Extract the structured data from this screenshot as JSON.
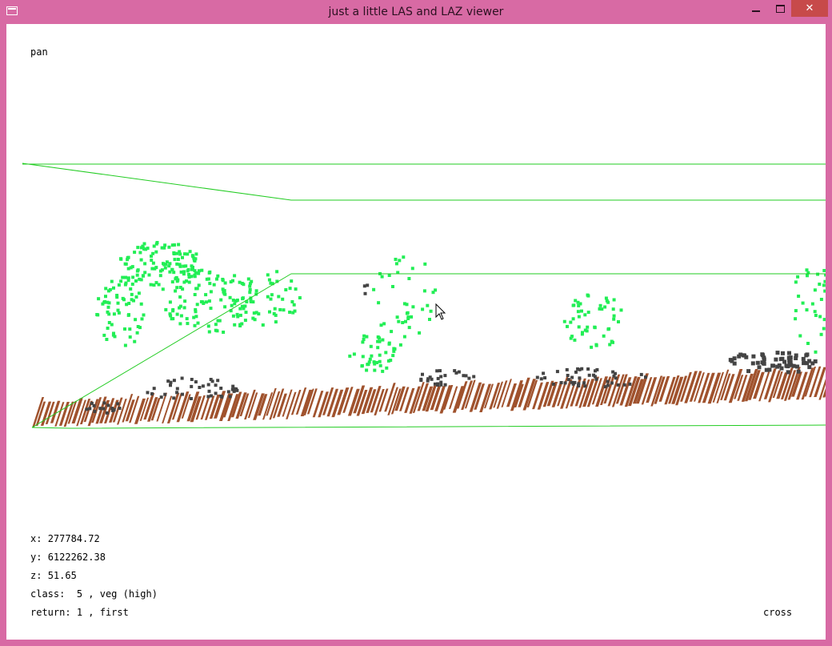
{
  "window": {
    "title": "just a little LAS and LAZ viewer",
    "controls": {
      "minimize_icon": "minimize-icon",
      "maximize_icon": "maximize-icon",
      "close_icon": "close-icon",
      "close_glyph": "✕"
    }
  },
  "hud": {
    "mode": "pan",
    "x_label": "x:",
    "x_value": "277784.72",
    "y_label": "y:",
    "y_value": "6122262.38",
    "z_label": "z:",
    "z_value": "51.65",
    "class_label": "class:",
    "class_code": "5",
    "class_name": "veg (high)",
    "return_label": "return:",
    "return_number": "1",
    "return_name": "first",
    "cursor_mode": "cross"
  },
  "colors": {
    "frame": "#d86aa4",
    "background": "#ffffff",
    "bounding_box": "#22cc22",
    "ground": "#a0522d",
    "vegetation": "#22ee55",
    "unclassified": "#444444"
  }
}
